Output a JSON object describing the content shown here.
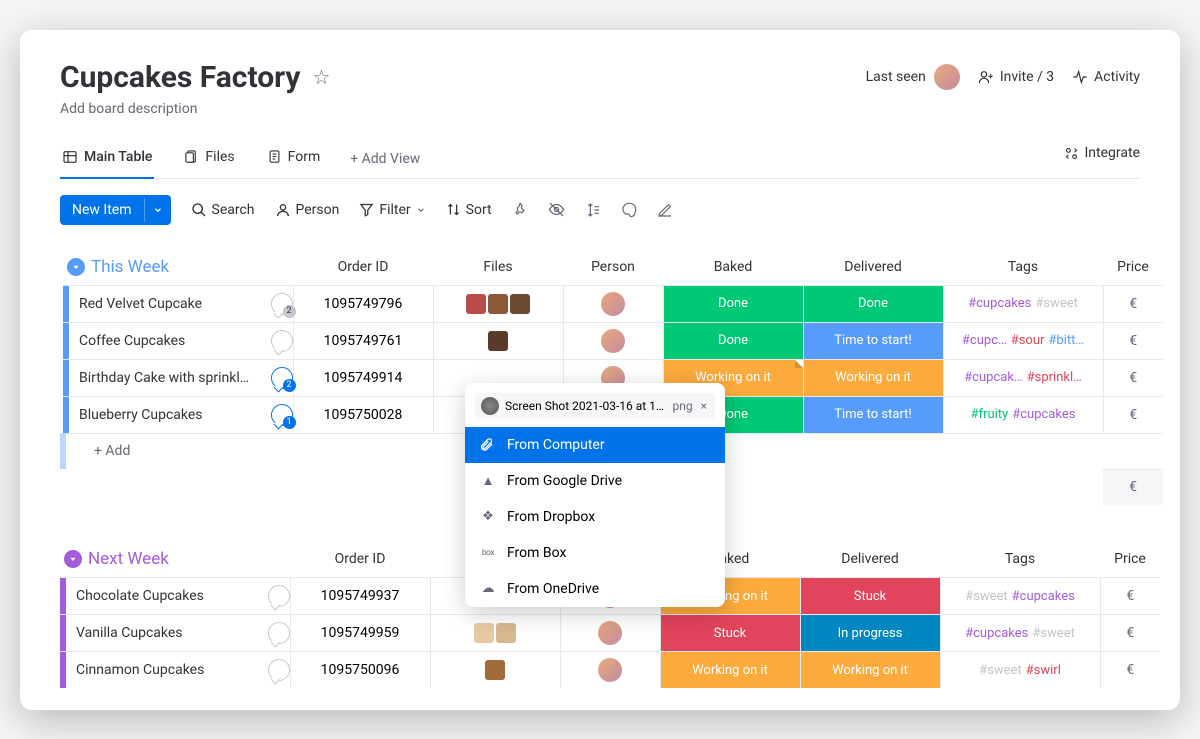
{
  "header": {
    "title": "Cupcakes Factory",
    "description": "Add board description",
    "last_seen_label": "Last seen",
    "invite_label": "Invite / 3",
    "activity_label": "Activity"
  },
  "views": {
    "tabs": [
      {
        "label": "Main Table",
        "active": true
      },
      {
        "label": "Files",
        "active": false
      },
      {
        "label": "Form",
        "active": false
      }
    ],
    "add_label": "+  Add View",
    "integrate_label": "Integrate"
  },
  "toolbar": {
    "new_item_label": "New Item",
    "search_label": "Search",
    "person_label": "Person",
    "filter_label": "Filter",
    "sort_label": "Sort"
  },
  "columns": [
    "Order ID",
    "Files",
    "Person",
    "Baked",
    "Delivered",
    "Tags",
    "Price"
  ],
  "upload": {
    "chip_name": "Screen Shot 2021-03-16 at 17....",
    "chip_ext": "png",
    "options": [
      {
        "label": "From Computer",
        "icon": "clip",
        "selected": true
      },
      {
        "label": "From Google Drive",
        "icon": "gdrive",
        "selected": false
      },
      {
        "label": "From Dropbox",
        "icon": "dropbox",
        "selected": false
      },
      {
        "label": "From Box",
        "icon": "box",
        "selected": false
      },
      {
        "label": "From OneDrive",
        "icon": "onedrive",
        "selected": false
      }
    ]
  },
  "groups": [
    {
      "title": "This Week",
      "color": "#579bfc",
      "class": "blue",
      "add_label": "+ Add",
      "rows": [
        {
          "name": "Red Velvet Cupcake",
          "order_id": "1095749796",
          "bubble": {
            "count": 2,
            "active": false
          },
          "files": [
            "#b84c4c",
            "#8c5a3a",
            "#6b4a2f"
          ],
          "baked": {
            "label": "Done",
            "color": "#00c875"
          },
          "delivered": {
            "label": "Done",
            "color": "#00c875"
          },
          "tags": [
            {
              "t": "#cupcakes",
              "c": "#a25ddc"
            },
            {
              "t": "#sweet",
              "c": "#c4c4c4"
            }
          ]
        },
        {
          "name": "Coffee Cupcakes",
          "order_id": "1095749761",
          "bubble": {
            "count": 0,
            "active": false
          },
          "files": [
            "#5a3a2a"
          ],
          "baked": {
            "label": "Done",
            "color": "#00c875"
          },
          "delivered": {
            "label": "Time to start!",
            "color": "#579bfc"
          },
          "tags": [
            {
              "t": "#cupc…",
              "c": "#a25ddc"
            },
            {
              "t": "#sour",
              "c": "#e2445c"
            },
            {
              "t": "#bitt…",
              "c": "#579bfc"
            }
          ]
        },
        {
          "name": "Birthday Cake with sprinkl…",
          "order_id": "1095749914",
          "bubble": {
            "count": 2,
            "active": true
          },
          "files": [],
          "baked": {
            "label": "Working on it",
            "color": "#fdab3d",
            "fold": true
          },
          "delivered": {
            "label": "Working on it",
            "color": "#fdab3d"
          },
          "tags": [
            {
              "t": "#cupcak…",
              "c": "#a25ddc"
            },
            {
              "t": "#sprinkl…",
              "c": "#e2445c"
            }
          ]
        },
        {
          "name": "Blueberry Cupcakes",
          "order_id": "1095750028",
          "bubble": {
            "count": 1,
            "active": true
          },
          "files": [],
          "baked": {
            "label": "Done",
            "color": "#00c875"
          },
          "delivered": {
            "label": "Time to start!",
            "color": "#579bfc"
          },
          "tags": [
            {
              "t": "#fruity",
              "c": "#00c875"
            },
            {
              "t": "#cupcakes",
              "c": "#a25ddc"
            }
          ]
        }
      ]
    },
    {
      "title": "Next Week",
      "color": "#a25ddc",
      "class": "purple",
      "rows": [
        {
          "name": "Chocolate Cupcakes",
          "order_id": "1095749937",
          "bubble": {
            "count": 0,
            "active": false
          },
          "files": [
            "#7a4a2a"
          ],
          "baked": {
            "label": "Working on it",
            "color": "#fdab3d"
          },
          "delivered": {
            "label": "Stuck",
            "color": "#e2445c"
          },
          "tags": [
            {
              "t": "#sweet",
              "c": "#c4c4c4"
            },
            {
              "t": "#cupcakes",
              "c": "#a25ddc"
            }
          ]
        },
        {
          "name": "Vanilla Cupcakes",
          "order_id": "1095749959",
          "bubble": {
            "count": 0,
            "active": false
          },
          "files": [
            "#e8c8a0",
            "#d8b890"
          ],
          "baked": {
            "label": "Stuck",
            "color": "#e2445c"
          },
          "delivered": {
            "label": "In progress",
            "color": "#0086c0"
          },
          "tags": [
            {
              "t": "#cupcakes",
              "c": "#a25ddc"
            },
            {
              "t": "#sweet",
              "c": "#c4c4c4"
            }
          ]
        },
        {
          "name": "Cinnamon Cupcakes",
          "order_id": "1095750096",
          "bubble": {
            "count": 0,
            "active": false
          },
          "files": [
            "#a06a3a"
          ],
          "baked": {
            "label": "Working on it",
            "color": "#fdab3d"
          },
          "delivered": {
            "label": "Working on it",
            "color": "#fdab3d"
          },
          "tags": [
            {
              "t": "#sweet",
              "c": "#c4c4c4"
            },
            {
              "t": "#swirl",
              "c": "#e2445c"
            }
          ]
        }
      ]
    }
  ]
}
